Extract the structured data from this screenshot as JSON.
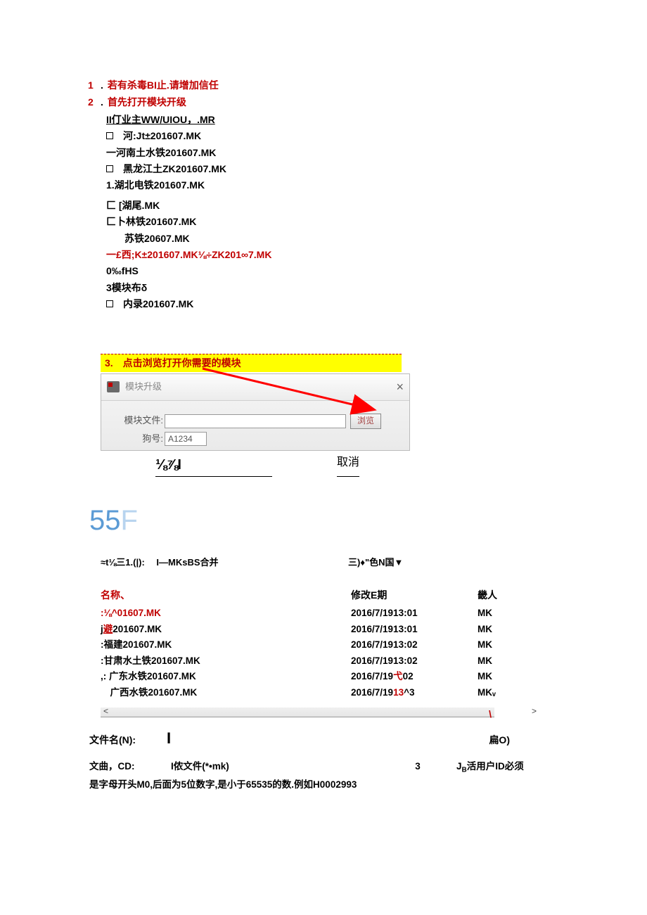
{
  "steps": {
    "s1": {
      "num": "1",
      "dot": ".",
      "text": "若有杀毒BI止.请增加信任"
    },
    "s2": {
      "num": "2",
      "dot": ".",
      "text": "首先打开模块开级"
    }
  },
  "sub": {
    "r1": "II仃业主WW/UIOU，.MR",
    "r2": "河:Jt±201607.MK",
    "r3": "一河南土水铁201607.MK",
    "r4": "黑龙江土ZK201607.MK",
    "r5": "1.湖北电铁201607.MK",
    "r6": "匚  [湖尾.MK",
    "r7": "匚卜林铁201607.MK",
    "r8": "苏铁20607.MK",
    "r9a": "一£西;K±201607.MK⅛÷ZK201∞7.MK",
    "r10": "0‰fHS",
    "r11": "3模块布δ",
    "r12": "内录201607.MK"
  },
  "step3": {
    "header": "3. 点击浏览打开你需要的模块",
    "dialog_title": "模块升级",
    "close": "×",
    "label_file": "模块文件:",
    "label_dog": "狗号:",
    "dog_value": "A1234",
    "browse": "浏览",
    "frac": "⅛⅞I",
    "cancel": "取消"
  },
  "big": {
    "num": "55",
    "f": "F"
  },
  "tbltop": {
    "left": "≈t⅛三1.(|):  I—MKsBS合并",
    "right": "三)♦\"色N国▼"
  },
  "filehdr": {
    "name": "名称、",
    "date": "修改E期",
    "type": "畿人"
  },
  "files": [
    {
      "name": ":⅛^01607.MK",
      "date": "2016/7/1913:01",
      "type": "MK",
      "nameClass": "red"
    },
    {
      "name_a": "j",
      "name_b": "避",
      "name_c": "201607.MK",
      "date": "2016/7/1913:01",
      "type": "MK",
      "splitUL": true
    },
    {
      "name": ":福建201607.MK",
      "date": "2016/7/1913:02",
      "type": "MK"
    },
    {
      "name": ":甘肃水土铁201607.MK",
      "date": "2016/7/1913:02",
      "type": "MK"
    },
    {
      "name": ",:  广东水铁201607.MK",
      "date_a": "2016/7/19",
      "date_b": "弋",
      "date_c": "02",
      "type": "MK",
      "splitDate": true
    },
    {
      "name": " 广西水铁201607.MK",
      "date_a": "2016/7/19",
      "date_b": "13",
      "date_c": "^3",
      "type": "MKᵥ",
      "splitDateRed": true
    }
  ],
  "scroll": {
    "left": "<",
    "right": ">",
    "slash": "\\"
  },
  "fnrow": {
    "label": "文件名(N):",
    "cursor": "I",
    "right": "扁O)"
  },
  "ftrow": {
    "c1": "文曲，CD:",
    "c2": "I侬文件(*•mk)",
    "c3": "3",
    "c4a": "J",
    "c4b": "B",
    "c4c": "活用户ID必须"
  },
  "note2": "是字母开头M0,后面为5位数字,是小于65535的数.例如H0002993"
}
